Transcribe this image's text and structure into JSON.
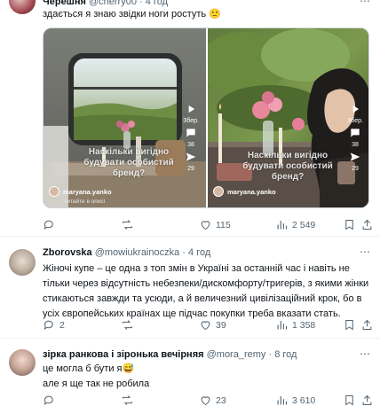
{
  "tweets": [
    {
      "name": "Черешня",
      "handle": "@cherry00",
      "time": "4 год",
      "text": "здається я знаю звідки ноги ростуть 🙂",
      "media": {
        "left": {
          "overlay": "Наскільки вигідно будувати особистий бренд?",
          "username": "maryana.yanko",
          "caption": "Читайте в описі",
          "bottom_text": "Наскільки вигідно будувати особистий бренд? | що",
          "counts": [
            "Збер.",
            "38",
            "29"
          ]
        },
        "right": {
          "overlay": "Наскільки вигідно будувати особистий бренд?",
          "username": "maryana.yanko",
          "caption": "",
          "bottom_text": "Наскільки вигідно будувати особистий бренд? | що",
          "counts": [
            "Збер.",
            "38",
            "29"
          ]
        }
      },
      "actions": {
        "replies": "",
        "retweets": "",
        "likes": "115",
        "views": "2 549"
      }
    },
    {
      "name": "Zborovska",
      "handle": "@mowiukrainoczka",
      "time": "4 год",
      "text": "Жіночі купе – це одна з топ змін в Україні за останній час і навіть не тільки через відсутність небезпеки/дискомфорту/тригерів, з якими жінки стикаються завжди та усюди, а й величезний цивілізаційний крок, бо в усіх європейських країнах ще підчас покупки треба вказати стать.",
      "actions": {
        "replies": "2",
        "retweets": "",
        "likes": "39",
        "views": "1 358"
      }
    },
    {
      "name": "зірка ранкова і зіронька вечірняя",
      "handle": "@mora_remy",
      "time": "8 год",
      "text_line1": "це могла б бути я😅",
      "text_line2": "але я ще так не робила",
      "actions": {
        "replies": "",
        "retweets": "",
        "likes": "23",
        "views": "3 610"
      }
    }
  ],
  "more_icon": "⋯",
  "icons": [
    "reply-icon",
    "retweet-icon",
    "like-icon",
    "views-icon",
    "bookmark-icon",
    "share-icon"
  ],
  "colors": {
    "text": "#0f1419",
    "muted": "#536471",
    "border": "#eff3f4"
  }
}
